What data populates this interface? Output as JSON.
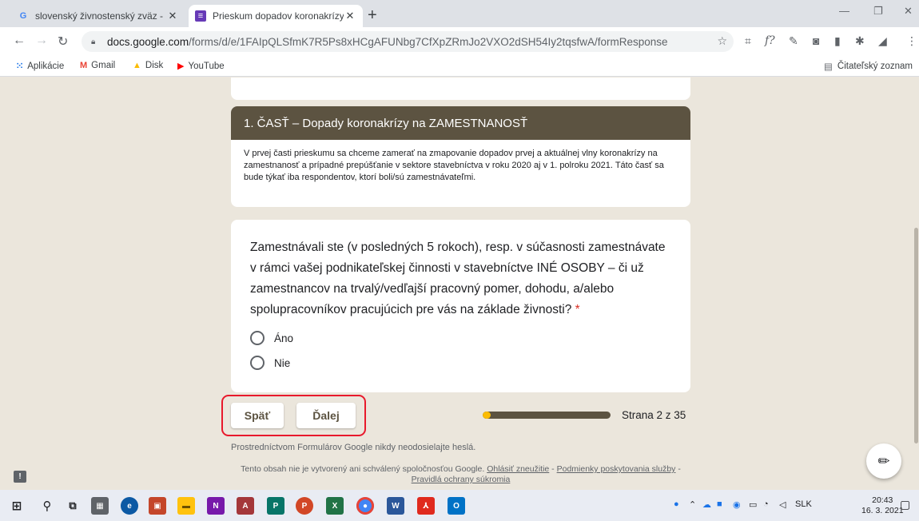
{
  "browser": {
    "tabs": [
      {
        "title": "slovenský živnostenský zväz - HĽ",
        "close": "✕",
        "icon": "google-g-icon"
      },
      {
        "title": "Prieskum dopadov koronakrízy n",
        "close": "✕",
        "icon": "google-forms-icon"
      }
    ],
    "new_tab": "+",
    "window_controls": {
      "minimize": "—",
      "restore": "❐",
      "close": "✕"
    },
    "url_host": "docs.google.com",
    "url_path": "/forms/d/e/1FAIpQLSfmK7R5Ps8xHCgAFUNbg7CfXpZRmJo2VXO2dSH54Iy2tqsfwA/formResponse",
    "bookmarks": [
      {
        "label": "Aplikácie",
        "icon": "apps-grid-icon"
      },
      {
        "label": "Gmail",
        "icon": "gmail-icon"
      },
      {
        "label": "Disk",
        "icon": "drive-icon"
      },
      {
        "label": "YouTube",
        "icon": "youtube-icon"
      }
    ],
    "reading_list": "Čitateľský zoznam"
  },
  "form": {
    "section_title": "1. ČASŤ – Dopady koronakrízy na ZAMESTNANOSŤ",
    "section_description": "V prvej časti prieskumu sa chceme zamerať na zmapovanie dopadov prvej a aktuálnej vlny koronakrízy na zamestnanosť a prípadné prepúšťanie v sektore stavebníctva v roku 2020 aj v 1. polroku 2021. Táto časť sa bude týkať iba respondentov, ktorí boli/sú zamestnávateľmi.",
    "question": {
      "text": "Zamestnávali ste (v posledných 5 rokoch), resp. v súčasnosti zamestnávate v rámci vašej podnikateľskej činnosti v stavebníctve INÉ OSOBY – či už zamestnancov na trvalý/vedľajší pracovný pomer, dohodu, a/alebo spolupracovníkov pracujúcich pre vás na základe živnosti?",
      "required_mark": "*",
      "options": [
        "Áno",
        "Nie"
      ]
    },
    "back_label": "Späť",
    "next_label": "Ďalej",
    "progress": {
      "current": 2,
      "total": 35,
      "label": "Strana 2 z 35"
    },
    "password_warning": "Prostredníctvom Formulárov Google nikdy neodosielajte heslá.",
    "disclaimer": {
      "text": "Tento obsah nie je vytvorený ani schválený spoločnosťou Google.",
      "report": "Ohlásiť zneužitie",
      "sep": " - ",
      "terms": "Podmienky poskytovania služby",
      "privacy": "Pravidlá ochrany súkromia"
    }
  },
  "taskbar": {
    "language": "SLK",
    "time": "20:43",
    "date": "16. 3. 2021"
  },
  "colors": {
    "accent": "#5c5341",
    "page_bg": "#ebe6dc",
    "highlight": "#e8192c",
    "progress_fill": "#fbbc04"
  }
}
